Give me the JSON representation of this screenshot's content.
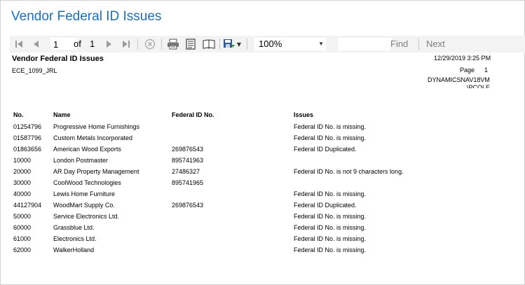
{
  "window": {
    "title": "Vendor Federal ID Issues"
  },
  "toolbar": {
    "current_page": "1",
    "of_label": "of",
    "total_pages": "1",
    "zoom": "100%",
    "find_label": "Find",
    "next_label": "Next",
    "icons": [
      "first-page-icon",
      "previous-page-icon",
      "next-page-icon",
      "last-page-icon",
      "stop-icon",
      "print-icon",
      "print-layout-icon",
      "page-setup-icon",
      "export-icon"
    ]
  },
  "report": {
    "title": "Vendor Federal ID Issues",
    "code": "ECE_1099_JRL",
    "datetime": "12/29/2019 3:25 PM",
    "page_label": "Page",
    "page_number": "1",
    "server": "DYNAMICSNAV18VM",
    "user": "\\PCOLE",
    "columns": [
      "No.",
      "Name",
      "Federal ID No.",
      "Issues"
    ],
    "rows": [
      {
        "no": "01254796",
        "name": "Progressive Home Furnishings",
        "fed_id": "",
        "issue": "Federal ID No. is missing."
      },
      {
        "no": "01587796",
        "name": "Custom Metals Incorporated",
        "fed_id": "",
        "issue": "Federal ID No. is missing."
      },
      {
        "no": "01863656",
        "name": "American Wood Exports",
        "fed_id": "269876543",
        "issue": "Federal ID Duplicated."
      },
      {
        "no": "10000",
        "name": "London Postmaster",
        "fed_id": "895741963",
        "issue": ""
      },
      {
        "no": "20000",
        "name": "AR Day Property Management",
        "fed_id": "27486327",
        "issue": "Federal ID No. is not 9 characters long."
      },
      {
        "no": "30000",
        "name": "CoolWood Technologies",
        "fed_id": "895741965",
        "issue": ""
      },
      {
        "no": "40000",
        "name": "Lewis Home Furniture",
        "fed_id": "",
        "issue": "Federal ID No. is missing."
      },
      {
        "no": "44127904",
        "name": "WoodMart Supply Co.",
        "fed_id": "269876543",
        "issue": "Federal ID Duplicated."
      },
      {
        "no": "50000",
        "name": "Service Electronics Ltd.",
        "fed_id": "",
        "issue": "Federal ID No. is missing."
      },
      {
        "no": "60000",
        "name": "Grassblue Ltd.",
        "fed_id": "",
        "issue": "Federal ID No. is missing."
      },
      {
        "no": "61000",
        "name": "Electronics Ltd.",
        "fed_id": "",
        "issue": "Federal ID No. is missing."
      },
      {
        "no": "62000",
        "name": "WalkerHolland",
        "fed_id": "",
        "issue": "Federal ID No. is missing."
      }
    ]
  }
}
